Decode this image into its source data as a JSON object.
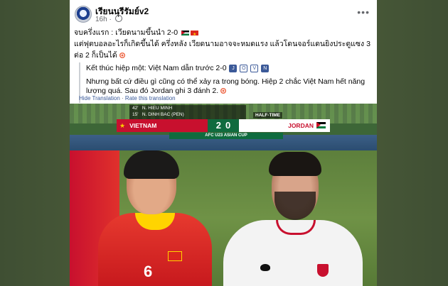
{
  "post": {
    "page_name": "เรียนนุรีรัมย์v2",
    "time": "16h",
    "more_label": "•••",
    "line1": "จบครึ่งแรก : เวียดนามขึ้นนำ 2-0",
    "line2": "แต่ฟุตบอลอะไรก็เกิดขึ้นได้ ครึ่งหลัง เวียดนามอาจจะหมดแรง แล้วโดนจอร์แดนยิงประตูแซง 3 ต่อ 2 ก็เป็นได้"
  },
  "translation": {
    "line1": "Kết thúc hiệp một: Việt Nam dẫn trước 2-0",
    "box_icons": [
      "J",
      "O",
      "V",
      "N"
    ],
    "line2": "Nhưng bất cứ điều gì cũng có thể xảy ra trong bóng. Hiệp 2 chắc Việt Nam hết năng lượng quá. Sau đó Jordan ghi 3 đánh 2.",
    "hide_label": "Hide Translation",
    "rate_label": "Rate this translation"
  },
  "scoreboard": {
    "goal1_minute": "42'",
    "goal1_player": "N. HIEU MINH",
    "goal2_minute": "15'",
    "goal2_player": "N. DINH BAC (PEN)",
    "status": "HALF-TIME",
    "home_team": "VIETNAM",
    "away_team": "JORDAN",
    "home_score": "2",
    "away_score": "0",
    "tournament": "AFC U23 ASIAN CUP"
  },
  "colors": {
    "vietnam_red": "#c8102e",
    "score_green": "#0f6b3e",
    "link_blue": "#385898"
  }
}
